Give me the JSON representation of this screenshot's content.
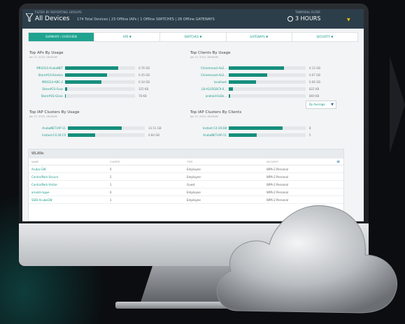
{
  "header": {
    "sub_label": "FILTER BY REPORTING GROUPS",
    "title": "All Devices",
    "summary": "174 Total Devices | 23 Offline IAPs | 1 Offline SWITCHES | 28 Offline GATEWAYS",
    "time_label": "TEMPORAL FILTER",
    "time_value": "3 HOURS"
  },
  "tabs": [
    {
      "label": "SUMMARY / OVERVIEW"
    },
    {
      "label": "APS ▼"
    },
    {
      "label": "SWITCHES ▼"
    },
    {
      "label": "GATEWAYS ▼"
    },
    {
      "label": "SECURITY ▼"
    }
  ],
  "top_aps": {
    "title": "Top APs By Usage",
    "date": "Jan 27, 2015, 08:00AM",
    "rows": [
      {
        "label": "MR4314-ArubaNET",
        "fill": 0.76,
        "value": "0.76 GB"
      },
      {
        "label": "Store#10-Kinston",
        "fill": 0.6,
        "value": "0.45 GB"
      },
      {
        "label": "MR4314-ABC-2",
        "fill": 0.52,
        "value": "0.34 GB"
      },
      {
        "label": "Store#23-Fuse",
        "fill": 0.03,
        "value": "325 KB"
      },
      {
        "label": "Store#03-Glass",
        "fill": 0.0,
        "value": "78 KB"
      }
    ]
  },
  "top_clients": {
    "title": "Top Clients By Usage",
    "date": "Jan 27, 2015, 08:00AM",
    "rows": [
      {
        "label": "Chromecast-Aa2...",
        "fill": 0.72,
        "value": "0.12 GB"
      },
      {
        "label": "Chromecast-Aa2...",
        "fill": 0.5,
        "value": "0.67 GB"
      },
      {
        "label": "localhost",
        "fill": 0.35,
        "value": "0.66 GB"
      },
      {
        "label": "LB-A1U5G8C9-0...",
        "fill": 0.05,
        "value": "822 KB"
      },
      {
        "label": "android-FaDe...",
        "fill": 0.02,
        "value": "869 KB"
      }
    ]
  },
  "top_iap_usage": {
    "title": "Top IAP Clusters By Usage",
    "date": "Jan 27, 2015, 08:00AM",
    "rows": [
      {
        "label": "ArubaNET-IAP-11",
        "fill": 0.7,
        "value": "13.51 GB"
      },
      {
        "label": "Instant-C4:30:C0",
        "fill": 0.35,
        "value": "0.84 GB"
      }
    ]
  },
  "top_iap_clients": {
    "title": "Top IAP Clusters By Clients",
    "date": "Jan 27, 2015, 08:00AM",
    "rows": [
      {
        "label": "Instant-C4:30:D8",
        "fill": 0.7,
        "value": "8"
      },
      {
        "label": "ArubaNET-IAP-11",
        "fill": 0.36,
        "value": "5"
      }
    ],
    "select_label": "By Average"
  },
  "wlans": {
    "title": "WLANs",
    "columns": [
      "NAME",
      "CLIENTS",
      "TYPE",
      "SECURITY"
    ],
    "rows": [
      {
        "name": "Aruba-GW",
        "clients": "0",
        "type": "Employee",
        "security": "WPA-2 Personal"
      },
      {
        "name": "CentralPark-Secure",
        "clients": "2",
        "type": "Employee",
        "security": "WPA-2 Personal"
      },
      {
        "name": "CentralPark-Visitor",
        "clients": "1",
        "type": "Guest",
        "security": "WPA-2 Personal"
      },
      {
        "name": "arnold-rogue",
        "clients": "0",
        "type": "Employee",
        "security": "WPA-2 Personal"
      },
      {
        "name": "SSID-ArubaGW",
        "clients": "1",
        "type": "Employee",
        "security": "WPA-2 Personal"
      }
    ]
  },
  "colors": {
    "accent": "#1fa38f",
    "header_bg": "#2c3e4a",
    "highlight": "#f0c000"
  }
}
